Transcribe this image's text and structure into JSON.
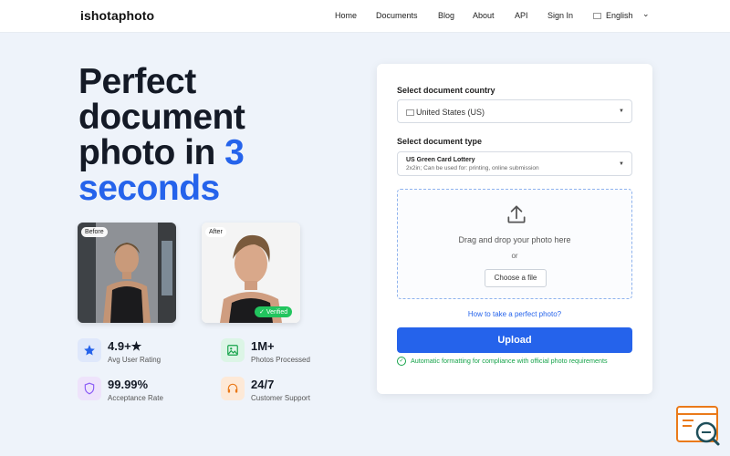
{
  "nav": {
    "logo": "ishotaphoto",
    "links": [
      "Home",
      "Documents",
      "Blog",
      "About",
      "API",
      "Sign In"
    ],
    "language": "English"
  },
  "hero": {
    "title_line1": "Perfect",
    "title_line2": "document",
    "title_line3a": "photo in ",
    "title_line3b": "3",
    "title_line4": "seconds"
  },
  "photos": {
    "before_label": "Before",
    "after_label": "After",
    "verified_label": "Verified"
  },
  "stats": [
    {
      "value": "4.9+★",
      "label": "Avg User Rating",
      "icon": "star-icon"
    },
    {
      "value": "1M+",
      "label": "Photos Processed",
      "icon": "image-icon"
    },
    {
      "value": "99.99%",
      "label": "Acceptance Rate",
      "icon": "shield-icon"
    },
    {
      "value": "24/7",
      "label": "Customer Support",
      "icon": "headset-icon"
    }
  ],
  "form": {
    "country_label": "Select document country",
    "country_value": "United States (US)",
    "type_label": "Select document type",
    "type_title": "US Green Card Lottery",
    "type_sub": "2x2in; Can be used for: printing, online submission",
    "drop_text": "Drag and drop your photo here",
    "drop_or": "or",
    "choose_label": "Choose a file",
    "howto_link": "How to take a perfect photo?",
    "upload_label": "Upload",
    "compliance_text": "Automatic formatting for compliance with official photo requirements"
  },
  "colors": {
    "accent": "#2563eb",
    "success": "#16a34a",
    "background": "#eef3fa"
  }
}
